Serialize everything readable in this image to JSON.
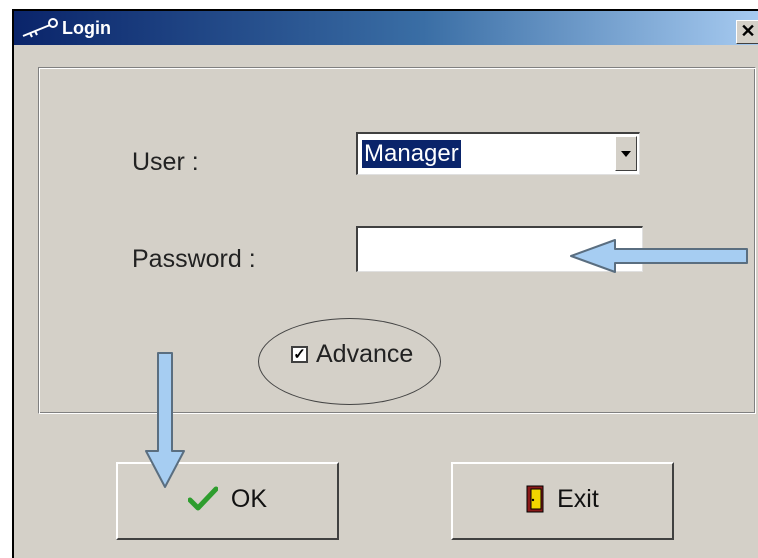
{
  "window": {
    "title": "Login",
    "close_glyph": "✕",
    "title_icon": "key-icon"
  },
  "form": {
    "user_label": "User :",
    "user_value": "Manager",
    "password_label": "Password :",
    "password_value": "",
    "advance_label": "Advance",
    "advance_checked": true
  },
  "buttons": {
    "ok_label": "OK",
    "ok_icon": "checkmark-icon",
    "exit_label": "Exit",
    "exit_icon": "door-exit-icon"
  },
  "colors": {
    "titlebar_start": "#0a246a",
    "titlebar_end": "#a6caf0",
    "dialog_bg": "#d4d0c8",
    "selection": "#0a246a",
    "arrow_fill": "#a6cdf2",
    "check_green": "#2e9d2e"
  }
}
